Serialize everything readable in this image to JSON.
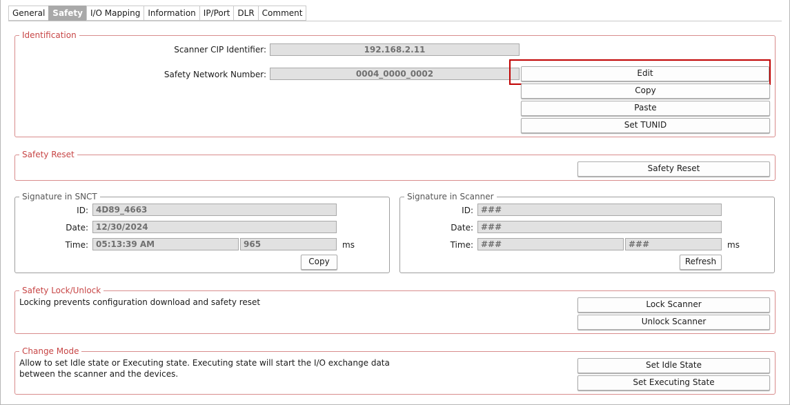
{
  "tabs": [
    {
      "label": "General"
    },
    {
      "label": "Safety"
    },
    {
      "label": "I/O Mapping"
    },
    {
      "label": "Information"
    },
    {
      "label": "IP/Port"
    },
    {
      "label": "DLR"
    },
    {
      "label": "Comment"
    }
  ],
  "active_tab": "Safety",
  "identification": {
    "title": "Identification",
    "cip_label": "Scanner CIP Identifier:",
    "cip_value": "192.168.2.11",
    "snn_label": "Safety Network Number:",
    "snn_value": "0004_0000_0002",
    "edit_label": "Edit",
    "copy_label": "Copy",
    "paste_label": "Paste",
    "set_tunid_label": "Set TUNID"
  },
  "safety_reset": {
    "title": "Safety Reset",
    "button_label": "Safety Reset"
  },
  "sig_snct": {
    "title": "Signature in SNCT",
    "id_label": "ID:",
    "id_value": "4D89_4663",
    "date_label": "Date:",
    "date_value": "12/30/2024",
    "time_label": "Time:",
    "time_value": "05:13:39 AM",
    "ms_value": "965",
    "ms_unit": "ms",
    "copy_label": "Copy"
  },
  "sig_scanner": {
    "title": "Signature in Scanner",
    "id_label": "ID:",
    "id_value": "###",
    "date_label": "Date:",
    "date_value": "###",
    "time_label": "Time:",
    "time_value": "###",
    "ms_value": "###",
    "ms_unit": "ms",
    "refresh_label": "Refresh"
  },
  "lock_unlock": {
    "title": "Safety Lock/Unlock",
    "description": "Locking prevents configuration download and safety reset",
    "lock_label": "Lock Scanner",
    "unlock_label": "Unlock Scanner"
  },
  "change_mode": {
    "title": "Change Mode",
    "description_line1": "Allow to set Idle state or Executing state. Executing state will start the I/O exchange data",
    "description_line2": "between the scanner and the devices.",
    "idle_label": "Set Idle State",
    "exec_label": "Set Executing State"
  },
  "colors": {
    "group_title": "#c74545",
    "group_border": "#d88b8b",
    "active_tab_bg": "#a9a9a9",
    "highlight": "#c00000"
  }
}
